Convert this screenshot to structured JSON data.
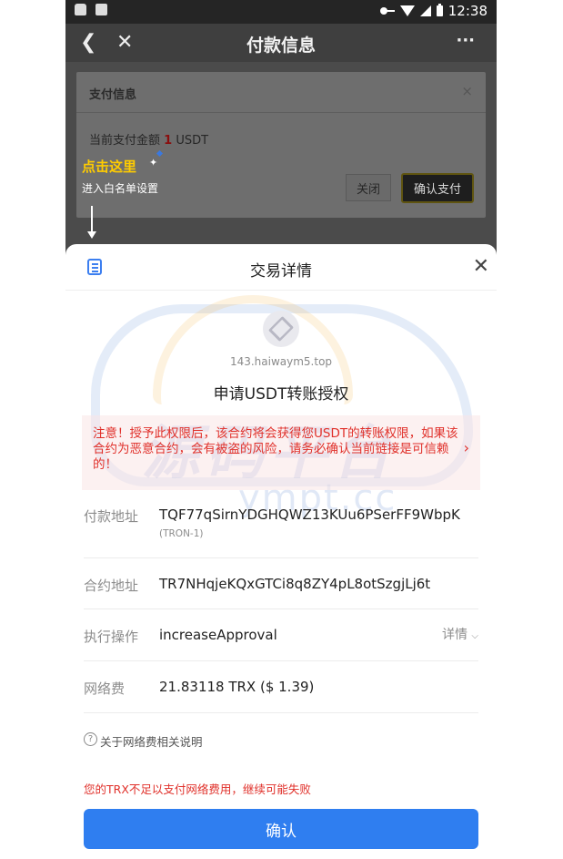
{
  "status_bar": {
    "time": "12:38",
    "icons": [
      "cat-icon",
      "image-icon",
      "key-icon",
      "wifi-icon",
      "signal-icon",
      "battery-icon"
    ]
  },
  "navbar": {
    "back_icon": "chevron-left-icon",
    "close_icon": "close-icon",
    "title": "付款信息",
    "more_label": "···"
  },
  "payment_card": {
    "title": "支付信息",
    "close_label": "×",
    "amount_prefix": "当前支付金额",
    "amount_value": "1",
    "amount_unit": "USDT",
    "close_button": "关闭",
    "confirm_button": "确认支付"
  },
  "annotation": {
    "main": "点击这里",
    "sub": "进入白名单设置"
  },
  "sheet": {
    "title": "交易详情",
    "list_icon": "list-icon",
    "close_label": "✕",
    "domain": "143.haiwaym5.top",
    "heading": "申请USDT转账授权",
    "warning": "注意！授予此权限后，该合约将会获得您USDT的转账权限，如果该合约为恶意合约，会有被盗的风险，请务必确认当前链接是可信赖的！",
    "warning_chevron": "›",
    "watermark_main": "源码平台",
    "watermark_url": "ympt.cc",
    "rows": [
      {
        "label": "付款地址",
        "value": "TQF77qSirnYDGHQWZ13KUu6PSerFF9WbpK",
        "sub": "(TRON-1)"
      },
      {
        "label": "合约地址",
        "value": "TR7NHqjeKQxGTCi8q8ZY4pL8otSzgjLj6t"
      },
      {
        "label": "执行操作",
        "value": "increaseApproval",
        "detail": "详情"
      },
      {
        "label": "网络费",
        "value": "21.83118 TRX ($ 1.39)"
      }
    ],
    "fee_help": "关于网络费相关说明",
    "fee_warning": "您的TRX不足以支付网络费用，继续可能失败",
    "confirm_button": "确认"
  },
  "colors": {
    "accent": "#2f7ef0",
    "warning": "#e0302a",
    "annotation": "#ffcc00"
  }
}
